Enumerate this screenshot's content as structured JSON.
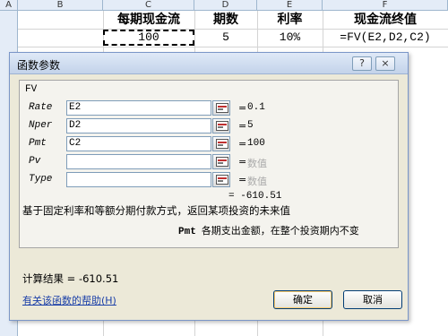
{
  "sheet": {
    "col_headers": [
      "A",
      "B",
      "C",
      "D",
      "E",
      "F"
    ],
    "row1": {
      "c": "每期现金流",
      "d": "期数",
      "e": "利率",
      "f": "现金流终值"
    },
    "row2": {
      "c": "100",
      "d": "5",
      "e": "10%",
      "f": "=FV(E2,D2,C2)"
    }
  },
  "dialog": {
    "title": "函数参数",
    "help_button": "?",
    "close_button": "×",
    "function_name": "FV",
    "args": [
      {
        "label": "Rate",
        "input": "E2",
        "value": "0.1"
      },
      {
        "label": "Nper",
        "input": "D2",
        "value": "5"
      },
      {
        "label": "Pmt",
        "input": "C2",
        "value": "100"
      },
      {
        "label": "Pv",
        "input": "",
        "value": "数值"
      },
      {
        "label": "Type",
        "input": "",
        "value": "数值"
      }
    ],
    "equals": "=",
    "result_preview": "= -610.51",
    "description": "基于固定利率和等额分期付款方式，返回某项投资的未来值",
    "arg_desc_key": "Pmt",
    "arg_desc_text": "各期支出金额，在整个投资期内不变",
    "calc_result": "计算结果 =  -610.51",
    "help_link": "有关该函数的帮助(H)",
    "ok_label": "确定",
    "cancel_label": "取消"
  },
  "colors": {
    "titlebar": "#c3d3ea",
    "dialog_bg": "#ece9d8",
    "link": "#1a3fa8",
    "placeholder": "#aaaaaa"
  }
}
